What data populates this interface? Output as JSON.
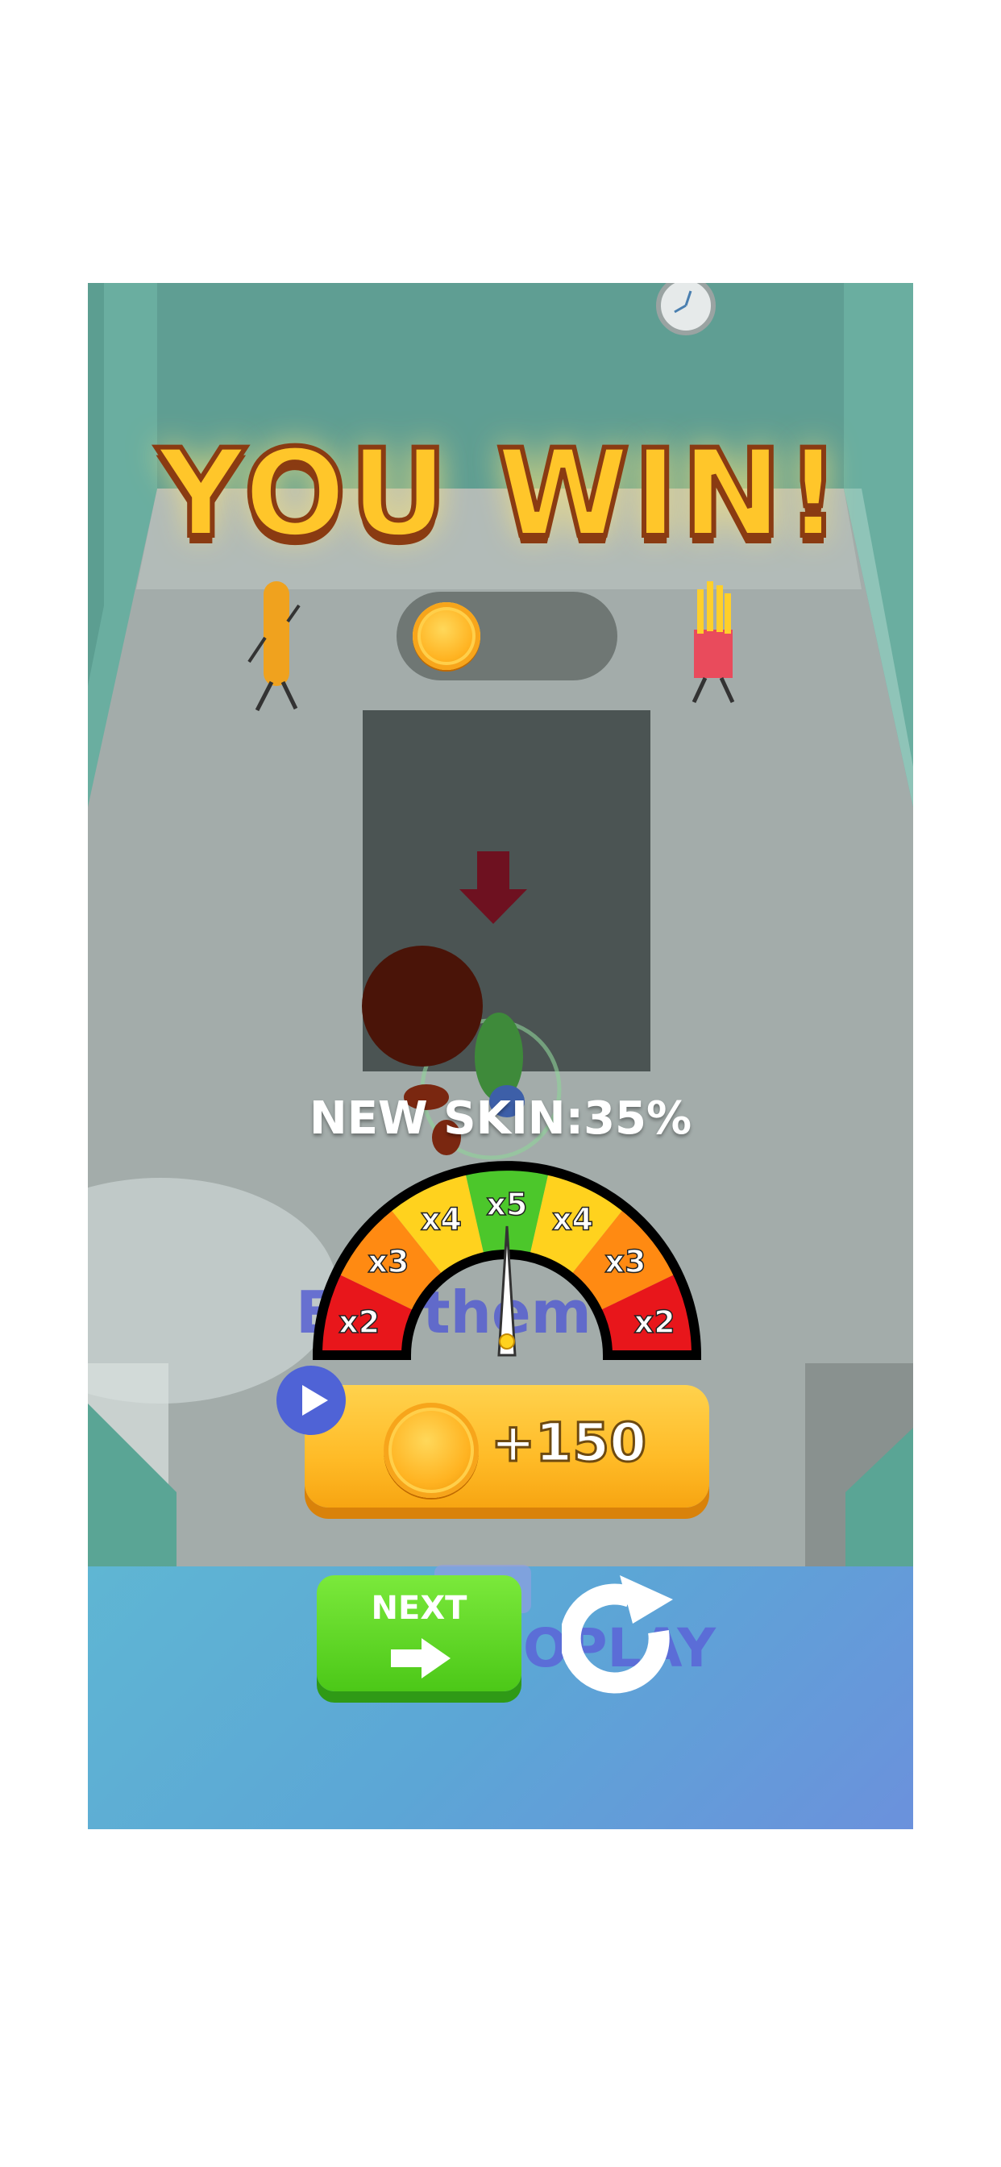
{
  "title": "YOU WIN!",
  "new_skin": {
    "label": "NEW SKIN:",
    "percent": "35%"
  },
  "background_text": {
    "floor_text": "Eat them a",
    "replay_text": "OPLAY"
  },
  "gauge": {
    "segments": [
      "x2",
      "x3",
      "x4",
      "x5",
      "x4",
      "x3",
      "x2"
    ],
    "colors": [
      "#e8161b",
      "#ff8a12",
      "#ffd21e",
      "#4cc72b",
      "#ffd21e",
      "#ff8a12",
      "#e8161b"
    ],
    "needle_value": "x5"
  },
  "reward_button": {
    "label": "+150",
    "icon": "coin-icon"
  },
  "video_icon": "play-icon",
  "next_button": {
    "label": "NEXT",
    "icon": "arrow-right-icon"
  },
  "replay_icon": "replay-icon",
  "colors": {
    "title": "#ffc62a",
    "next": "#55cf1c",
    "reward": "#ffbb27",
    "floor": "#5fb0d6"
  }
}
